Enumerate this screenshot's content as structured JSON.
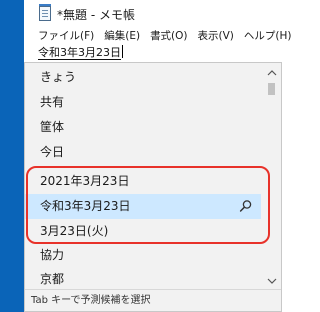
{
  "window": {
    "title": "*無題 - メモ帳"
  },
  "menubar": {
    "items": [
      "ファイル(F)",
      "編集(E)",
      "書式(O)",
      "表示(V)",
      "ヘルプ(H)"
    ]
  },
  "editor": {
    "composition_text": "令和3年3月23日"
  },
  "candidates": {
    "items": [
      "きょう",
      "共有",
      "筐体",
      "今日",
      "2021年3月23日",
      "令和3年3月23日",
      "3月23日(火)",
      "協力",
      "京都"
    ],
    "selected_index": 5,
    "selected_icon": "search-icon",
    "hint": "Tab キーで予測候補を選択"
  },
  "colors": {
    "selection": "#cde8ff",
    "highlight": "#e8322a",
    "desktop": "#0a64b8"
  }
}
